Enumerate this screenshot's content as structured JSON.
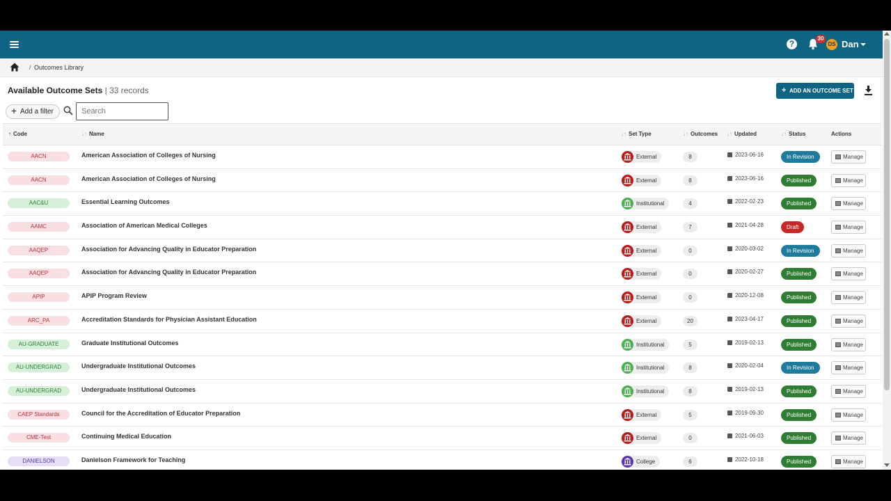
{
  "header": {
    "help_icon": "question-circle-icon",
    "notifications_count": "30",
    "avatar_initials": "DS",
    "user_name": "Dan",
    "bar_color": "#0f6484"
  },
  "breadcrumb": {
    "separator": "/",
    "current": "Outcomes Library"
  },
  "page": {
    "title": "Available Outcome Sets",
    "record_count": "| 33 records",
    "add_button_label": "ADD AN OUTCOME SET",
    "add_button_plus": "+"
  },
  "filters": {
    "add_filter_plus": "+",
    "add_filter_label": "Add a filter",
    "search_placeholder": "Search"
  },
  "table": {
    "columns": {
      "code": "Code",
      "name": "Name",
      "set_type": "Set Type",
      "outcomes": "Outcomes",
      "updated": "Updated",
      "status": "Status",
      "actions": "Actions"
    },
    "sort_arrow_up": "↑",
    "sort_arrow_both": "↓↑",
    "manage_label": "Manage",
    "rows": [
      {
        "code": "AACN",
        "code_color": "red",
        "name": "American Association of Colleges of Nursing",
        "set_type": "External",
        "outcomes": "8",
        "updated": "2023-06-16",
        "status": "In Revision"
      },
      {
        "code": "AACN",
        "code_color": "red",
        "name": "American Association of Colleges of Nursing",
        "set_type": "External",
        "outcomes": "8",
        "updated": "2023-06-16",
        "status": "Published"
      },
      {
        "code": "AAC&U",
        "code_color": "green",
        "name": "Essential Learning Outcomes",
        "set_type": "Institutional",
        "outcomes": "4",
        "updated": "2022-02-23",
        "status": "Published"
      },
      {
        "code": "AAMC",
        "code_color": "red",
        "name": "Association of American Medical Colleges",
        "set_type": "External",
        "outcomes": "7",
        "updated": "2021-04-28",
        "status": "Draft"
      },
      {
        "code": "AAQEP",
        "code_color": "red",
        "name": "Association for Advancing Quality in Educator Preparation",
        "set_type": "External",
        "outcomes": "0",
        "updated": "2020-03-02",
        "status": "In Revision"
      },
      {
        "code": "AAQEP",
        "code_color": "red",
        "name": "Association for Advancing Quality in Educator Preparation",
        "set_type": "External",
        "outcomes": "0",
        "updated": "2020-02-27",
        "status": "Published"
      },
      {
        "code": "APIP",
        "code_color": "red",
        "name": "APIP Program Review",
        "set_type": "External",
        "outcomes": "0",
        "updated": "2020-12-08",
        "status": "Published"
      },
      {
        "code": "ARC_PA",
        "code_color": "red",
        "name": "Accreditation Standards for Physician Assistant Education",
        "set_type": "External",
        "outcomes": "20",
        "updated": "2023-04-17",
        "status": "Published"
      },
      {
        "code": "AU-GRADUATE",
        "code_color": "green",
        "name": "Graduate Institutional Outcomes",
        "set_type": "Institutional",
        "outcomes": "5",
        "updated": "2019-02-13",
        "status": "Published"
      },
      {
        "code": "AU-UNDERGRAD",
        "code_color": "green",
        "name": "Undergraduate Institutional Outcomes",
        "set_type": "Institutional",
        "outcomes": "8",
        "updated": "2020-02-04",
        "status": "In Revision"
      },
      {
        "code": "AU-UNDERGRAD",
        "code_color": "green",
        "name": "Undergraduate Institutional Outcomes",
        "set_type": "Institutional",
        "outcomes": "8",
        "updated": "2019-02-13",
        "status": "Published"
      },
      {
        "code": "CAEP Standards",
        "code_color": "red",
        "name": "Council for the Accreditation of Educator Preparation",
        "set_type": "External",
        "outcomes": "5",
        "updated": "2019-09-30",
        "status": "Published"
      },
      {
        "code": "CME-Test",
        "code_color": "red",
        "name": "Continuing Medical Education",
        "set_type": "External",
        "outcomes": "0",
        "updated": "2021-06-03",
        "status": "Published"
      },
      {
        "code": "DANIELSON",
        "code_color": "purple",
        "name": "Danielson Framework for Teaching",
        "set_type": "College",
        "outcomes": "6",
        "updated": "2022-10-18",
        "status": "Published"
      }
    ]
  },
  "colors": {
    "primary": "#0f6484",
    "published": "#2e7d32",
    "in_revision": "#1e7b9c",
    "draft": "#c62828",
    "external": "#b71c1c",
    "institutional": "#4caf50",
    "college": "#5e35b1"
  }
}
